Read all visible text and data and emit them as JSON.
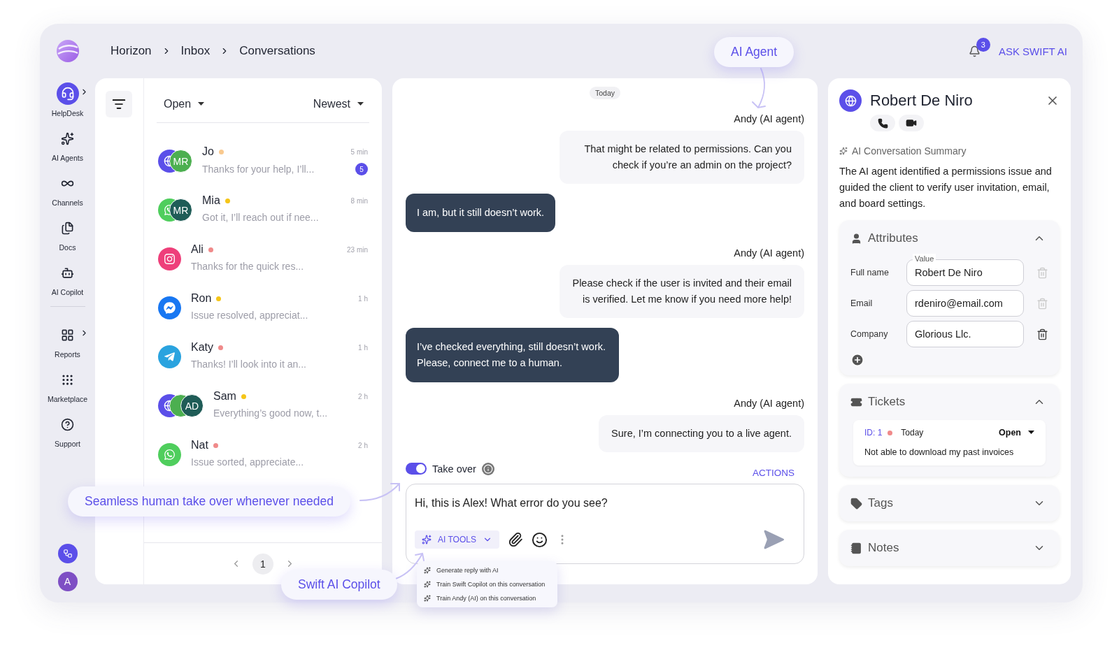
{
  "breadcrumb": [
    "Horizon",
    "Inbox",
    "Conversations"
  ],
  "topbar": {
    "notification_count": "3",
    "ask_button": "ASK SWIFT AI"
  },
  "sidebar": {
    "groups": [
      {
        "items": [
          {
            "label": "HelpDesk",
            "selected": true,
            "submenu": true
          },
          {
            "label": "AI Agents",
            "selected": false,
            "submenu": false
          },
          {
            "label": "Channels",
            "selected": false,
            "submenu": false
          },
          {
            "label": "Docs",
            "selected": false,
            "submenu": false
          },
          {
            "label": "AI Copilot",
            "selected": false,
            "submenu": false
          }
        ]
      },
      {
        "items": [
          {
            "label": "Reports",
            "selected": false,
            "submenu": true
          },
          {
            "label": "Marketplace",
            "selected": false,
            "submenu": false
          },
          {
            "label": "Support",
            "selected": false,
            "submenu": false
          }
        ]
      }
    ],
    "user_avatar": "A"
  },
  "conversation_list": {
    "status_filter": "Open",
    "sort": "Newest",
    "conversations": [
      {
        "name": "Jo",
        "kind": "web",
        "avatars": [
          {
            "initials": "MR",
            "color": "#4caf50"
          }
        ],
        "color": "#f9c98f",
        "time": "5 min",
        "preview": "Thanks for your help, I’ll...",
        "unread": "5"
      },
      {
        "name": "Mia",
        "kind": "whatsapp",
        "avatars": [
          {
            "initials": "MR",
            "color": "#1f5c57"
          }
        ],
        "color": "#f5c518",
        "time": "8 min",
        "preview": "Got it, I’ll reach out if nee..."
      },
      {
        "name": "Ali",
        "kind": "instagram",
        "color": "#f08a8a",
        "time": "23 min",
        "preview": "Thanks for the quick res..."
      },
      {
        "name": "Ron",
        "kind": "messenger",
        "color": "#f5c518",
        "time": "1 h",
        "preview": "Issue resolved, appreciat..."
      },
      {
        "name": "Katy",
        "kind": "telegram",
        "color": "#f08a8a",
        "time": "1 h",
        "preview": "Thanks! I’ll look into it an..."
      },
      {
        "name": "Sam",
        "kind": "web",
        "avatars": [
          {
            "color": "#4caf50"
          },
          {
            "initials": "AD",
            "color": "#1f5c57"
          }
        ],
        "color": "#f5c518",
        "time": "2 h",
        "preview": "Everything’s good now, t..."
      },
      {
        "name": "Nat",
        "kind": "whatsapp",
        "color": "#f08a8a",
        "time": "2 h",
        "preview": "Issue sorted, appreciate..."
      }
    ],
    "pagination": {
      "page": "1"
    }
  },
  "chat": {
    "date": "Today",
    "messages": [
      {
        "kind": "agent",
        "sender": "Andy (AI agent)",
        "text": "That might be related to permissions. Can you check if you’re an admin on the project?"
      },
      {
        "kind": "customer",
        "text": "I am, but it still doesn’t work."
      },
      {
        "kind": "agent",
        "sender": "Andy (AI agent)",
        "text": "Please check if the user is invited and their email is verified. Let me know if you need more help!"
      },
      {
        "kind": "customer",
        "text": "I’ve checked everything, still doesn’t work. Please, connect me to a human."
      },
      {
        "kind": "agent",
        "sender": "Andy (AI agent)",
        "text": "Sure, I’m connecting you to a live agent."
      }
    ],
    "take_over": {
      "label": "Take over",
      "on": true
    },
    "actions": "ACTIONS",
    "composer": {
      "value": "Hi, this is Alex! What error do you see?",
      "ai_tools": "AI TOOLS"
    },
    "ai_menu": [
      "Generate reply with AI",
      "Train Swift Copilot on this conversation",
      "Train Andy (AI) on this conversation"
    ]
  },
  "contact": {
    "name": "Robert De Niro",
    "summary_title": "AI Conversation Summary",
    "summary": "The AI agent identified a permissions issue and guided the client to verify user invitation, email, and board settings.",
    "sections": [
      {
        "kind": "attributes",
        "title": "Attributes",
        "expanded": true,
        "fields": [
          {
            "label": "Full name",
            "floating_label": "Value",
            "value": "Robert De Niro"
          },
          {
            "label": "Email",
            "value": "rdeniro@email.com"
          },
          {
            "label": "Company",
            "value": "Glorious Llc."
          }
        ]
      },
      {
        "kind": "tickets",
        "title": "Tickets",
        "expanded": true,
        "tickets": [
          {
            "id": "ID: 1",
            "color": "#f08a8a",
            "date": "Today",
            "status": "Open",
            "text": "Not able to download my past invoices"
          }
        ]
      },
      {
        "kind": "tags",
        "title": "Tags",
        "expanded": false
      },
      {
        "kind": "notes",
        "title": "Notes",
        "expanded": false
      }
    ]
  },
  "callouts": [
    {
      "kind": "agent",
      "text": "AI Agent"
    },
    {
      "kind": "takeover",
      "text": "Seamless human take over whenever needed"
    },
    {
      "kind": "copilot",
      "text": "Swift AI Copilot"
    }
  ]
}
